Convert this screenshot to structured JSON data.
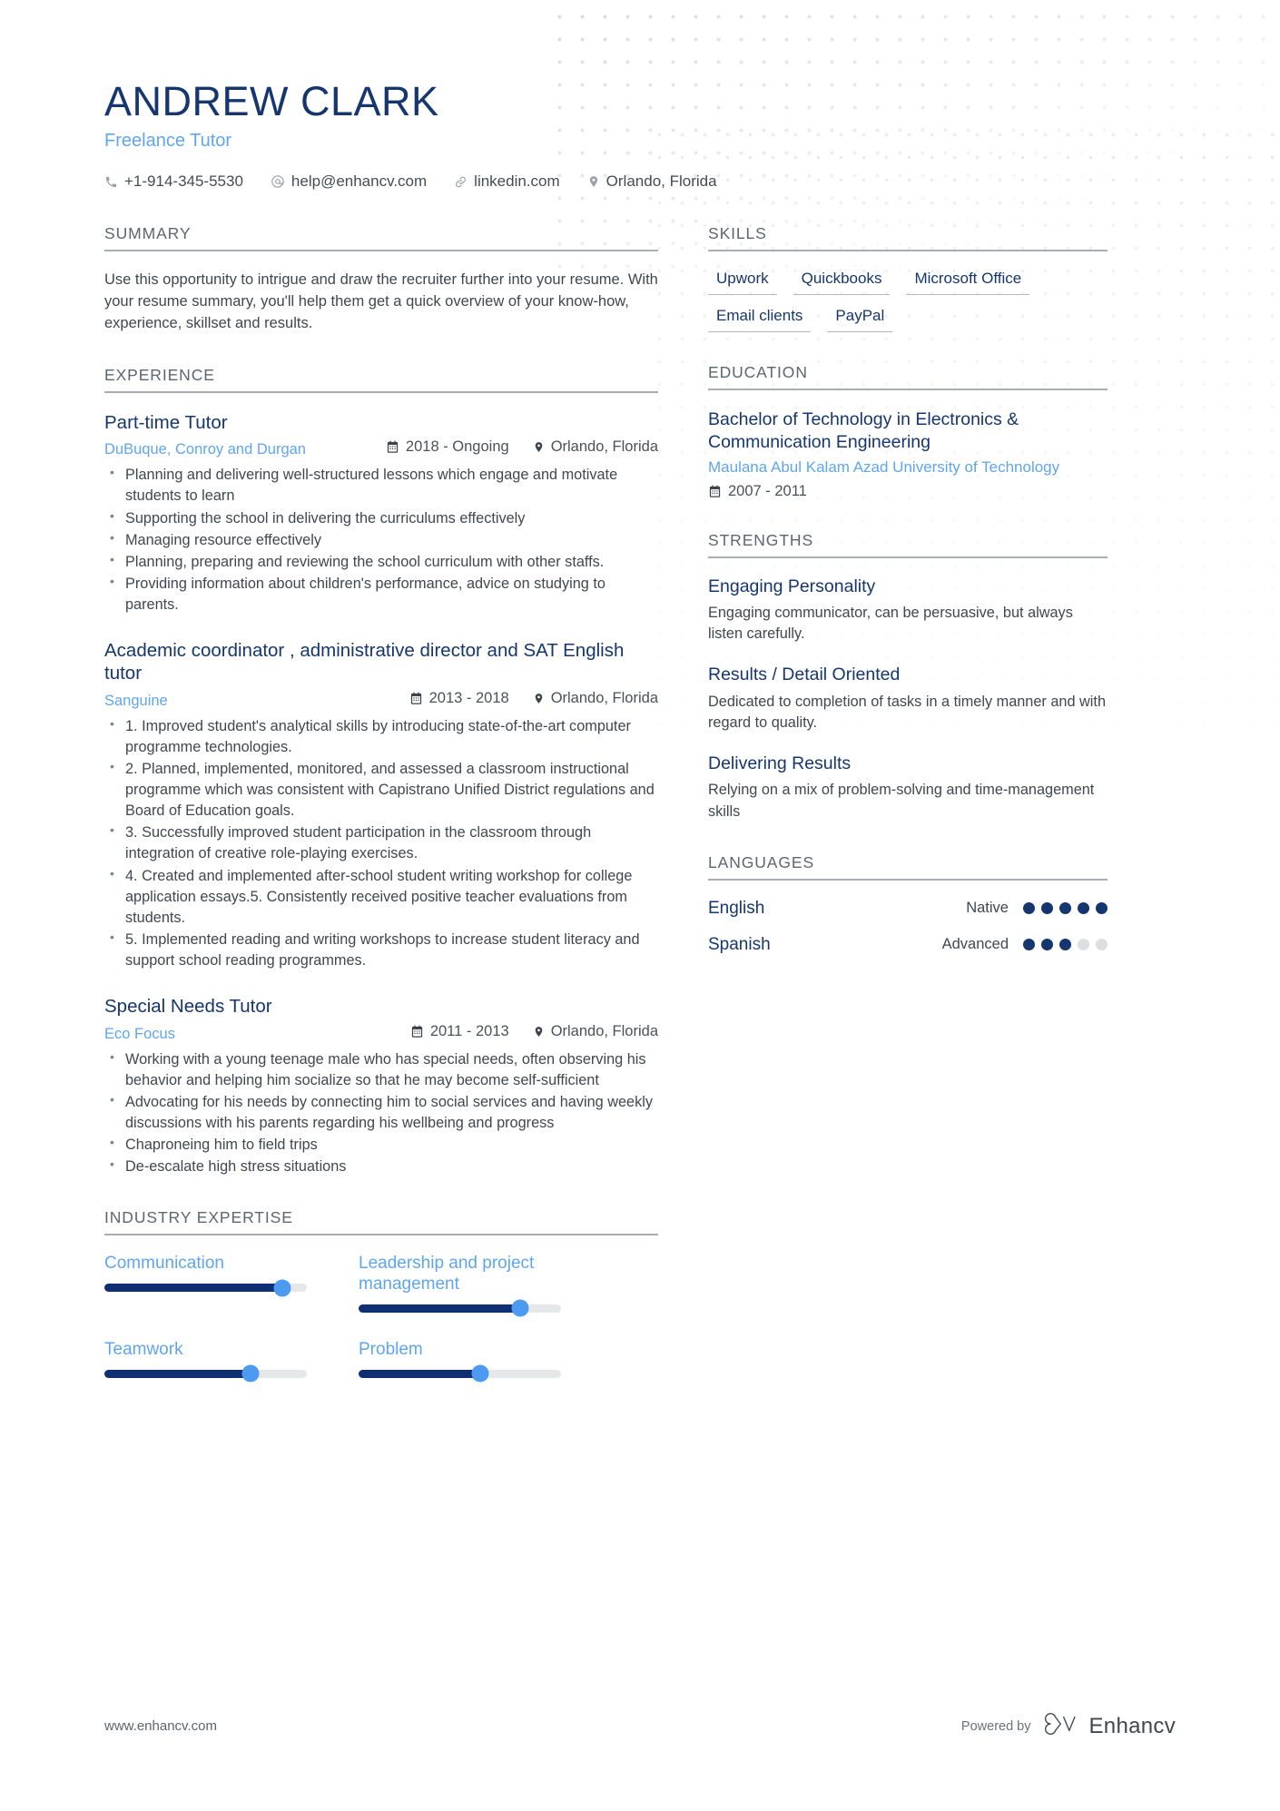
{
  "header": {
    "name": "ANDREW CLARK",
    "job_title": "Freelance Tutor",
    "contacts": [
      {
        "icon": "phone-icon",
        "text": "+1-914-345-5530"
      },
      {
        "icon": "email-icon",
        "text": "help@enhancv.com"
      },
      {
        "icon": "link-icon",
        "text": "linkedin.com"
      },
      {
        "icon": "location-icon",
        "text": "Orlando, Florida"
      }
    ]
  },
  "summary": {
    "heading": "SUMMARY",
    "text": "Use this opportunity to intrigue and draw the recruiter further into your resume. With your resume summary, you'll help them get a quick overview of your know-how, experience, skillset and results."
  },
  "experience": {
    "heading": "EXPERIENCE",
    "items": [
      {
        "title": "Part-time Tutor",
        "company": "DuBuque, Conroy and Durgan",
        "date": "2018 - Ongoing",
        "location": "Orlando, Florida",
        "bullets": [
          "Planning and delivering well-structured lessons which engage and motivate students to learn",
          "Supporting the school in delivering the curriculums effectively",
          "Managing resource effectively",
          "Planning, preparing and reviewing the school curriculum with other staffs.",
          "Providing information about children's performance, advice on studying to parents."
        ]
      },
      {
        "title": "Academic coordinator , administrative director and SAT English tutor",
        "company": "Sanguine",
        "date": "2013 - 2018",
        "location": "Orlando, Florida",
        "bullets": [
          "1. Improved student's analytical skills by introducing state-of-the-art computer programme technologies.",
          "2. Planned, implemented, monitored, and assessed a classroom instructional programme which was consistent with Capistrano Unified District regulations and Board of Education goals.",
          "3. Successfully improved student participation in the classroom through integration of creative role-playing exercises.",
          "4. Created and implemented after-school student writing workshop for college application essays.5. Consistently received positive teacher evaluations from students.",
          "5. Implemented reading and writing workshops to increase student literacy and support school reading programmes."
        ]
      },
      {
        "title": "Special Needs Tutor",
        "company": "Eco Focus",
        "date": "2011 - 2013",
        "location": "Orlando, Florida",
        "bullets": [
          "Working with a young teenage male who has special needs, often observing his behavior and helping him socialize so that he may become self-sufficient",
          "Advocating for his needs by connecting him to social services and having weekly discussions with his parents regarding his wellbeing and progress",
          "Chaproneing him to field trips",
          "De-escalate high stress situations"
        ]
      }
    ]
  },
  "industry_expertise": {
    "heading": "INDUSTRY EXPERTISE",
    "items": [
      {
        "label": "Communication",
        "percent": 88
      },
      {
        "label": "Leadership and project management",
        "percent": 80
      },
      {
        "label": "Teamwork",
        "percent": 72
      },
      {
        "label": "Problem",
        "percent": 60
      }
    ]
  },
  "skills": {
    "heading": "SKILLS",
    "tags": [
      "Upwork",
      "Quickbooks",
      "Microsoft Office",
      "Email clients",
      "PayPal"
    ]
  },
  "education": {
    "heading": "EDUCATION",
    "items": [
      {
        "degree": "Bachelor of Technology in Electronics & Communication Engineering",
        "school": "Maulana Abul Kalam Azad University of Technology",
        "date": "2007 - 2011"
      }
    ]
  },
  "strengths": {
    "heading": "STRENGTHS",
    "items": [
      {
        "title": "Engaging Personality",
        "description": "Engaging communicator, can be persuasive, but always listen carefully."
      },
      {
        "title": "Results / Detail Oriented",
        "description": "Dedicated to completion of tasks in a timely manner and with regard to quality."
      },
      {
        "title": "Delivering Results",
        "description": "Relying on a mix of problem-solving and time-management skills"
      }
    ]
  },
  "languages": {
    "heading": "LANGUAGES",
    "items": [
      {
        "name": "English",
        "level": "Native",
        "filled": 5,
        "total": 5
      },
      {
        "name": "Spanish",
        "level": "Advanced",
        "filled": 3,
        "total": 5
      }
    ]
  },
  "footer": {
    "url": "www.enhancv.com",
    "powered_by": "Powered by",
    "brand": "Enhancv"
  },
  "colors": {
    "primary_dark_blue": "#15366f",
    "accent_light_blue": "#5fa6ee",
    "slider_fill": "#0e2f73",
    "slider_knob": "#4d9bf0",
    "body_text": "#40474f",
    "rule_gray": "#a9aeb3"
  }
}
